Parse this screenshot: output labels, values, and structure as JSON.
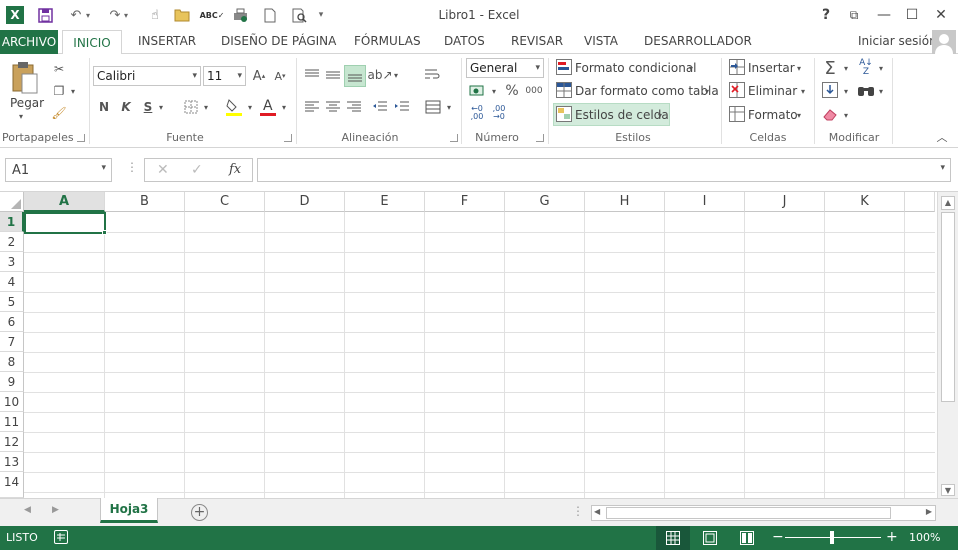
{
  "app": {
    "window_title": "Libro1 - Excel",
    "logo_letter": "X",
    "sign_in": "Iniciar sesión"
  },
  "qat": {
    "icons": [
      "excel-logo-icon",
      "save-icon",
      "undo-icon",
      "redo-icon",
      "touch-mode-icon",
      "open-icon",
      "spelling-icon",
      "print-preview-icon",
      "new-icon",
      "search-icon",
      "customize-qat-icon"
    ]
  },
  "window_controls": {
    "help": "?",
    "restore_ribbon": "⧉",
    "minimize": "—",
    "maximize": "☐",
    "close": "✕"
  },
  "ribbon_tabs": [
    "ARCHIVO",
    "INICIO",
    "INSERTAR",
    "DISEÑO DE PÁGINA",
    "FÓRMULAS",
    "DATOS",
    "REVISAR",
    "VISTA",
    "DESARROLLADOR"
  ],
  "clipboard": {
    "paste": "Pegar",
    "label": "Portapapeles"
  },
  "font": {
    "name": "Calibri",
    "size": "11",
    "bold": "N",
    "italic": "K",
    "underline": "S",
    "label": "Fuente"
  },
  "alignment": {
    "label": "Alineación"
  },
  "number": {
    "format": "General",
    "label": "Número"
  },
  "styles": {
    "conditional": "Formato condicional",
    "as_table": "Dar formato como tabla",
    "cell_styles": "Estilos de celda",
    "label": "Estilos"
  },
  "cells": {
    "insert": "Insertar",
    "delete": "Eliminar",
    "format": "Formato",
    "label": "Celdas"
  },
  "editing": {
    "label": "Modificar"
  },
  "formula_bar": {
    "name_box": "A1",
    "fx": "fx",
    "value": ""
  },
  "columns": [
    "A",
    "B",
    "C",
    "D",
    "E",
    "F",
    "G",
    "H",
    "I",
    "J",
    "K"
  ],
  "rows": [
    "1",
    "2",
    "3",
    "4",
    "5",
    "6",
    "7",
    "8",
    "9",
    "10",
    "11",
    "12",
    "13",
    "14"
  ],
  "sheets": [
    "Hoja3"
  ],
  "status": {
    "mode": "LISTO",
    "zoom": "100%"
  },
  "colors": {
    "accent": "#217346",
    "selection": "#217346"
  }
}
